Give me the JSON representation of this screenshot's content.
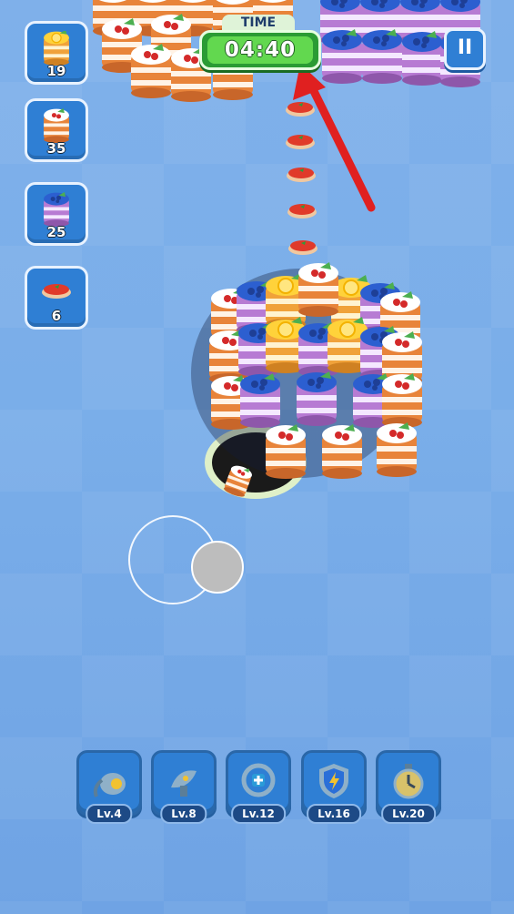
{
  "goals": [
    {
      "name": "lemon-cake-goal",
      "icon": "lemon-cake-icon",
      "count": "19"
    },
    {
      "name": "cherry-cake-goal",
      "icon": "cherry-cake-icon",
      "count": "35"
    },
    {
      "name": "blueberry-cake-goal",
      "icon": "blueberry-cake-icon",
      "count": "25"
    },
    {
      "name": "tomato-slice-goal",
      "icon": "tomato-slice-icon",
      "count": "6"
    }
  ],
  "timer": {
    "label": "TIME",
    "value": "04:40"
  },
  "pause": {
    "label": "II"
  },
  "powerups": [
    {
      "name": "vacuum-powerup",
      "icon": "vacuum-icon",
      "level": "Lv.4"
    },
    {
      "name": "radar-powerup",
      "icon": "satellite-dish-icon",
      "level": "Lv.8"
    },
    {
      "name": "magnet-powerup",
      "icon": "target-icon",
      "level": "Lv.12"
    },
    {
      "name": "shield-powerup",
      "icon": "shield-lightning-icon",
      "level": "Lv.16"
    },
    {
      "name": "clock-powerup",
      "icon": "stopwatch-icon",
      "level": "Lv.20"
    }
  ],
  "colors": {
    "background": "#7aaee9",
    "panel": "#2f7fd4",
    "timer": "#62d84f",
    "arrow": "#e02020"
  }
}
